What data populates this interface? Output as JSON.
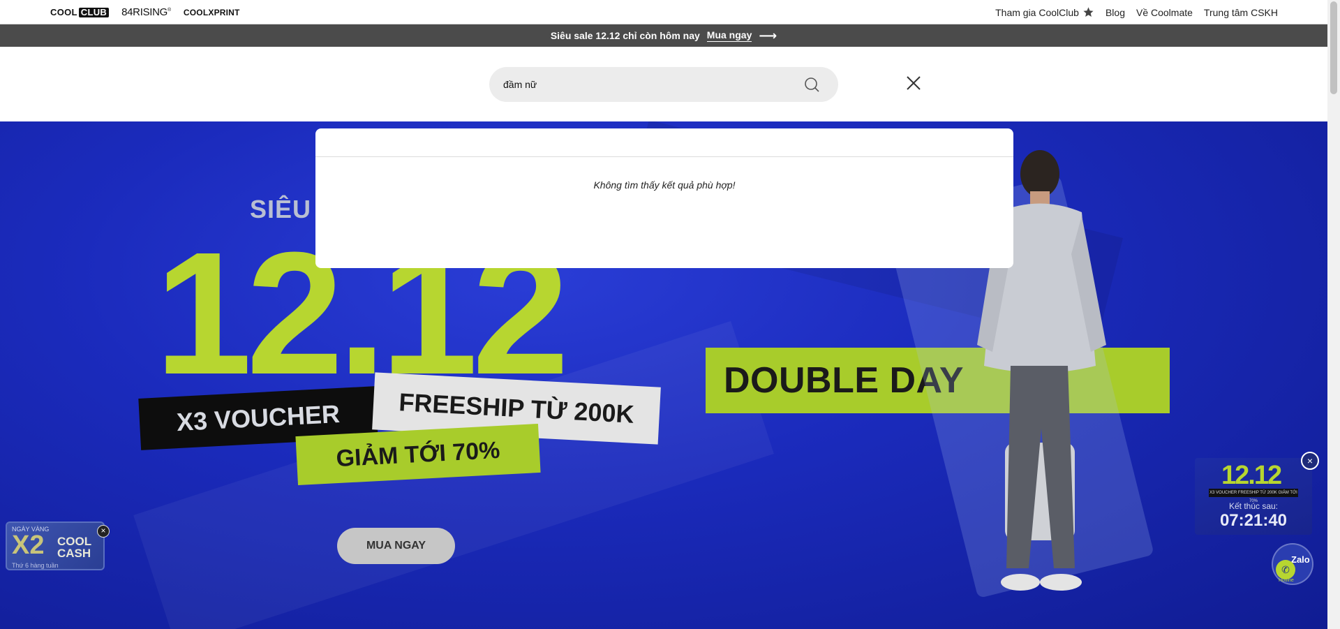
{
  "topbar": {
    "brands": {
      "coolclub_cool": "COOL",
      "coolclub_club": "CLUB",
      "rising": "84RISING",
      "rising_mark": "®",
      "coolxprint": "COOLXPRINT"
    },
    "nav": {
      "join_club": "Tham gia CoolClub",
      "blog": "Blog",
      "about": "Về Coolmate",
      "support": "Trung tâm CSKH"
    }
  },
  "promo": {
    "text": "Siêu sale 12.12 chỉ còn hôm nay",
    "cta": "Mua ngay",
    "arrow": "⟶"
  },
  "search": {
    "value": "đầm nữ",
    "placeholder": ""
  },
  "results": {
    "empty_message": "Không tìm thấy kết quả phù hợp!"
  },
  "hero": {
    "sieu": "SIÊU",
    "big": "12.12",
    "voucher": "X3 VOUCHER",
    "freeship": "FREESHIP TỪ 200K",
    "discount": "GIẢM TỚI 70%",
    "button": "MUA NGAY",
    "double_day": "DOUBLE DAY"
  },
  "widgets": {
    "cash": {
      "top": "NGÀY VÀNG",
      "x2": "X2",
      "cool": "COOL",
      "cashword": "CASH",
      "bottom": "Thứ 6 hàng tuần",
      "close": "×"
    },
    "timer": {
      "title": "12.12",
      "sub": "X3 VOUCHER  FREESHIP TỪ 200K  GIẢM TỚI 70%",
      "ends": "Kết thúc sau:",
      "clock": "07:21:40",
      "close": "×"
    },
    "zalo": {
      "label": "Zalo",
      "hotline": "Hotline"
    }
  },
  "icons": {
    "search": "search-icon",
    "close": "close-icon",
    "star": "star-icon",
    "phone": "phone-icon"
  }
}
